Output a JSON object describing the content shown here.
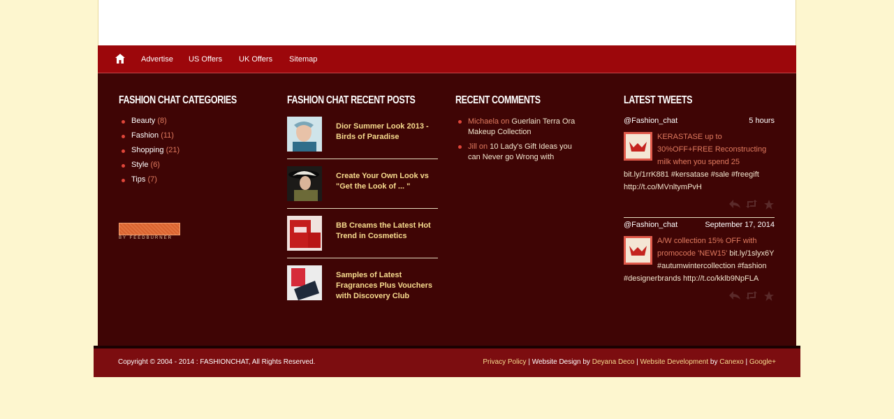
{
  "nav": {
    "home_icon": "home-icon",
    "items": [
      "Advertise",
      "US Offers",
      "UK Offers",
      "Sitemap"
    ]
  },
  "categories": {
    "title": "Fashion Chat Categories",
    "items": [
      {
        "label": "Beauty",
        "count": "(8)"
      },
      {
        "label": "Fashion",
        "count": "(11)"
      },
      {
        "label": "Shopping",
        "count": "(21)"
      },
      {
        "label": "Style",
        "count": "(6)"
      },
      {
        "label": "Tips",
        "count": "(7)"
      }
    ],
    "feedburner_label": "BY FEEDBURNER"
  },
  "recent_posts": {
    "title": "Fashion Chat Recent Posts",
    "items": [
      {
        "title": "Dior Summer Look 2013 - Birds of Paradise"
      },
      {
        "title": "Create Your Own Look vs \"Get the Look of ... \""
      },
      {
        "title": "BB Creams the Latest Hot Trend in Cosmetics"
      },
      {
        "title": "Samples of Latest Fragrances Plus Vouchers with Discovery Club"
      }
    ]
  },
  "recent_comments": {
    "title": "Recent Comments",
    "items": [
      {
        "author": "Michaela",
        "on": "on",
        "post": "Guerlain Terra Ora Makeup Collection"
      },
      {
        "author": "Jill",
        "on": "on",
        "post": "10 Lady's Gift Ideas you can Never go Wrong with"
      }
    ]
  },
  "tweets": {
    "title": "Latest Tweets",
    "items": [
      {
        "handle": "@Fashion_chat",
        "time": "5 hours",
        "highlight": "KERASTASE up to 30%OFF+FREE Reconstructing milk when you spend 25",
        "rest": "bit.ly/1rrK881 #kersatase #sale #freegift http://t.co/MVnltymPvH"
      },
      {
        "handle": "@Fashion_chat",
        "time": "September 17, 2014",
        "highlight": "A/W collection 15% OFF with promocode 'NEW15'",
        "rest": "bit.ly/1slyx6Y #autumwintercollection #fashion #designerbrands http://t.co/kklb9NpFLA"
      }
    ]
  },
  "footer": {
    "copyright": "Copyright © 2004 - 2014 : FASHIONCHAT, All Rights Reserved.",
    "privacy": "Privacy Policy",
    "sep1": "|",
    "design_text": "Website Design by",
    "designer": "Deyana Deco",
    "sep2": "|",
    "dev": "Website Development",
    "by": "by",
    "developer": "Canexo",
    "sep3": "|",
    "google": "Google+"
  }
}
